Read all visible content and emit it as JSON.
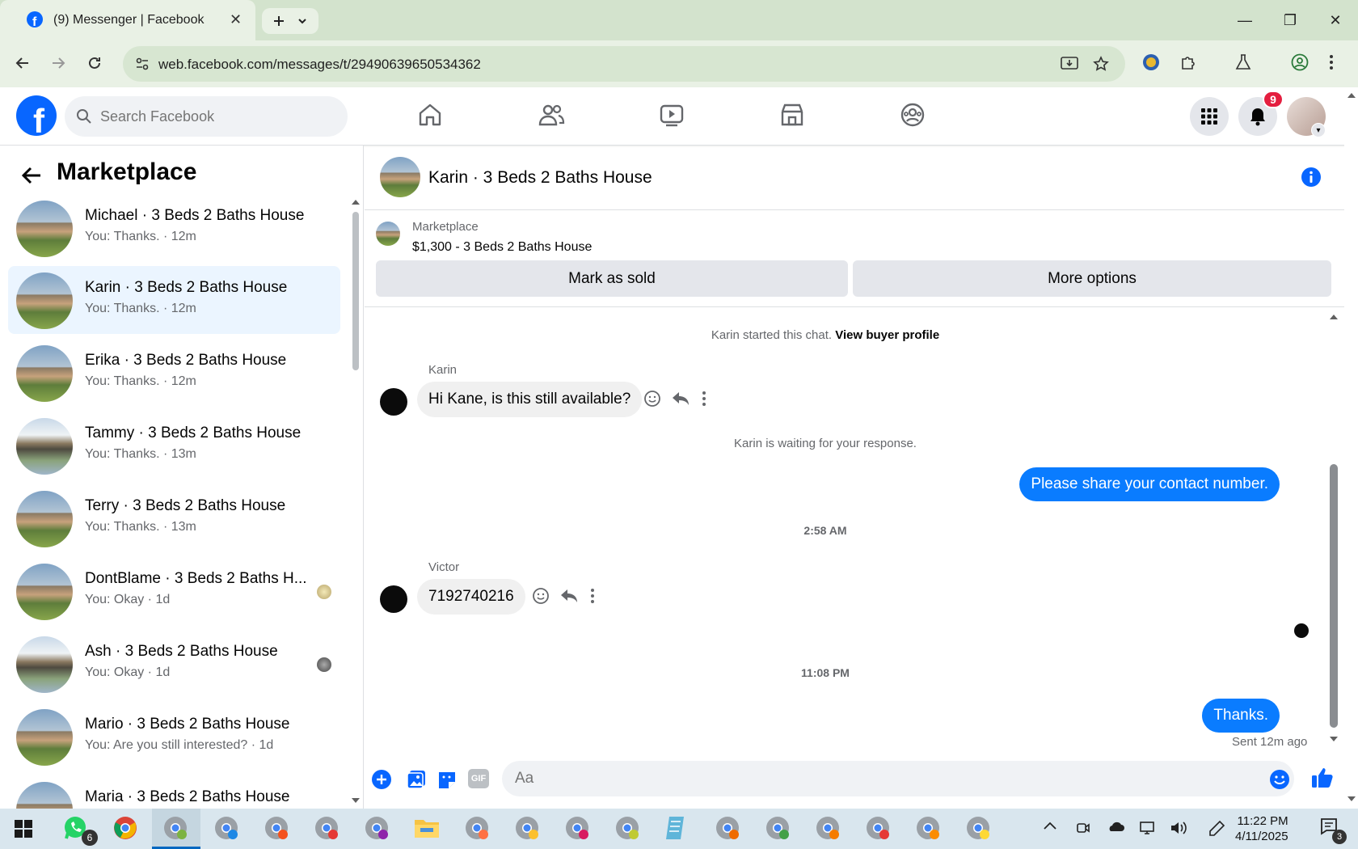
{
  "browser": {
    "tab_title": "(9) Messenger | Facebook",
    "url": "web.facebook.com/messages/t/29490639650534362"
  },
  "fb": {
    "logo_letter": "f",
    "search_placeholder": "Search Facebook",
    "notif_count": "9",
    "accent": "#0866ff"
  },
  "sidebar": {
    "title": "Marketplace",
    "conversations": [
      {
        "name": "Michael · 3 Beds 2 Baths House",
        "sub": "You: Thanks. · 12m"
      },
      {
        "name": "Karin · 3 Beds 2 Baths House",
        "sub": "You: Thanks. · 12m"
      },
      {
        "name": "Erika · 3 Beds 2 Baths House",
        "sub": "You: Thanks. · 12m"
      },
      {
        "name": "Tammy · 3 Beds 2 Baths House",
        "sub": "You: Thanks. · 13m"
      },
      {
        "name": "Terry · 3 Beds 2 Baths House",
        "sub": "You: Thanks. · 13m"
      },
      {
        "name": "DontBlame · 3 Beds 2 Baths H...",
        "sub": "You: Okay · 1d"
      },
      {
        "name": "Ash · 3 Beds 2 Baths House",
        "sub": "You: Okay · 1d"
      },
      {
        "name": "Mario · 3 Beds 2 Baths House",
        "sub": "You: Are you still interested? · 1d"
      },
      {
        "name": "Maria · 3 Beds 2 Baths House",
        "sub": ""
      }
    ]
  },
  "chat": {
    "title": "Karin · 3 Beds 2 Baths House",
    "marketplace_label": "Marketplace",
    "listing": "$1,300 - 3 Beds 2 Baths House",
    "mark_sold": "Mark as sold",
    "more_options": "More options",
    "started": "Karin started this chat.",
    "view_profile": "View buyer profile",
    "sender1": "Karin",
    "msg1": "Hi Kane, is this still available?",
    "waiting": "Karin is waiting for your response.",
    "out1": "Please share your contact number.",
    "time1": "2:58 AM",
    "sender2": "Victor",
    "msg2": "7192740216",
    "time2": "11:08 PM",
    "out2": "Thanks.",
    "sent": "Sent 12m ago",
    "composer_placeholder": "Aa",
    "gif": "GIF"
  },
  "taskbar": {
    "whatsapp_badge": "6",
    "time": "11:22 PM",
    "date": "4/11/2025",
    "notif_badge": "3"
  }
}
